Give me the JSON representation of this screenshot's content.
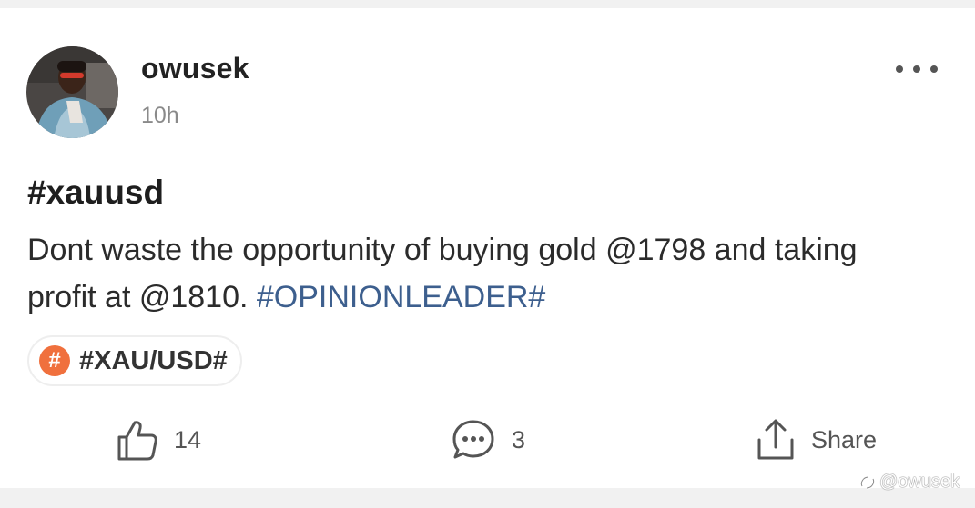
{
  "post": {
    "author": {
      "username": "owusek",
      "time": "10h"
    },
    "title": "#xauusd",
    "body_text": "Dont waste the opportunity of buying gold @1798 and taking profit at @1810. ",
    "body_hashtag": "#OPINIONLEADER#",
    "topic": {
      "icon": "#",
      "label": "#XAU/USD#",
      "icon_color": "#f0703d"
    },
    "actions": {
      "like_count": "14",
      "comment_count": "3",
      "share_label": "Share"
    },
    "icons": {
      "more": "more-horizontal-icon",
      "like": "thumbs-up-icon",
      "comment": "chat-bubble-icon",
      "share": "share-upload-icon"
    },
    "colors": {
      "hashtag_link": "#3d5f8e",
      "background": "#ffffff",
      "page": "#f1f1f1"
    }
  },
  "watermark": "@owusek"
}
